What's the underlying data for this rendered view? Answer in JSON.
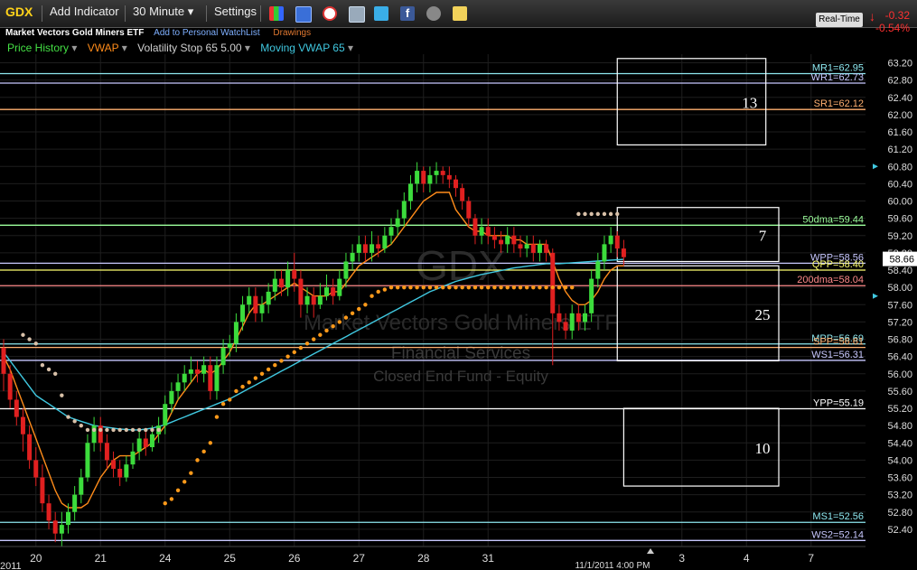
{
  "toolbar": {
    "symbol": "GDX",
    "add_indicator": "Add Indicator",
    "interval": "30 Minute",
    "settings": "Settings",
    "realtime": "Real-Time",
    "change": "-0.32",
    "change_pct": "-0.54%"
  },
  "subbar": {
    "name": "Market Vectors Gold Miners ETF",
    "watchlist": "Add to Personal WatchList",
    "drawings": "Drawings"
  },
  "indicators": [
    {
      "label": "Price History",
      "color": "#44e044"
    },
    {
      "label": "VWAP",
      "color": "#ff8c1a"
    },
    {
      "label": "Volatility Stop 65 5.00",
      "color": "#cfcfcf"
    },
    {
      "label": "Moving VWAP 65",
      "color": "#40c8e0"
    }
  ],
  "watermark": {
    "symbol": "GDX",
    "name": "Market Vectors Gold Miners ETF",
    "sector": "Financial Services",
    "category": "Closed End Fund - Equity"
  },
  "chart_data": {
    "type": "candlestick",
    "ylim": [
      52.0,
      63.4
    ],
    "y_ticks": [
      "63.20",
      "62.80",
      "62.40",
      "62.00",
      "61.60",
      "61.20",
      "60.80",
      "60.40",
      "60.00",
      "59.60",
      "59.20",
      "58.80",
      "58.40",
      "58.00",
      "57.60",
      "57.20",
      "56.80",
      "56.40",
      "56.00",
      "55.60",
      "55.20",
      "54.80",
      "54.40",
      "54.00",
      "53.60",
      "53.20",
      "52.80",
      "52.40"
    ],
    "x_labels": [
      {
        "label": "20",
        "i": 5
      },
      {
        "label": "21",
        "i": 15
      },
      {
        "label": "24",
        "i": 25
      },
      {
        "label": "25",
        "i": 35
      },
      {
        "label": "26",
        "i": 45
      },
      {
        "label": "27",
        "i": 55
      },
      {
        "label": "28",
        "i": 65
      },
      {
        "label": "31",
        "i": 75
      },
      {
        "label": "3",
        "i": 105
      },
      {
        "label": "4",
        "i": 115
      },
      {
        "label": "7",
        "i": 125
      }
    ],
    "year_label": "2011",
    "cursor_date": "11/1/2011 4:00 PM",
    "last_price": "58.66",
    "levels": [
      {
        "label": "MR1=62.95",
        "value": 62.95,
        "color": "#8ee8f0"
      },
      {
        "label": "WR1=62.73",
        "value": 62.73,
        "color": "#c8c8ff"
      },
      {
        "label": "SR1=62.12",
        "value": 62.12,
        "color": "#ffb070"
      },
      {
        "label": "50dma=59.44",
        "value": 59.44,
        "color": "#9cff9c"
      },
      {
        "label": "WPP=58.56",
        "value": 58.56,
        "color": "#c8c8ff"
      },
      {
        "label": "QPP=58.40",
        "value": 58.4,
        "color": "#ffff70"
      },
      {
        "label": "200dma=58.04",
        "value": 58.04,
        "color": "#ff8a8a"
      },
      {
        "label": "MPP=56.69",
        "value": 56.69,
        "color": "#8ee8f0"
      },
      {
        "label": "SPP=56.61",
        "value": 56.61,
        "color": "#ffb070"
      },
      {
        "label": "WS1=56.31",
        "value": 56.31,
        "color": "#c8c8ff"
      },
      {
        "label": "YPP=55.19",
        "value": 55.19,
        "color": "#ffffff"
      },
      {
        "label": "MS1=52.56",
        "value": 52.56,
        "color": "#8ee8f0"
      },
      {
        "label": "WS2=52.14",
        "value": 52.14,
        "color": "#c8c8ff"
      }
    ],
    "boxes": [
      {
        "label": "13",
        "i0": 95,
        "i1": 118,
        "top": 63.3,
        "bottom": 61.3
      },
      {
        "label": "7",
        "i0": 95,
        "i1": 120,
        "top": 59.85,
        "bottom": 58.6
      },
      {
        "label": "25",
        "i0": 95,
        "i1": 120,
        "top": 58.5,
        "bottom": 56.3
      },
      {
        "label": "10",
        "i0": 96,
        "i1": 120,
        "top": 55.2,
        "bottom": 53.4
      }
    ],
    "candles": [
      [
        56.6,
        56.0,
        56.8,
        55.6
      ],
      [
        56.0,
        55.4,
        56.2,
        55.2
      ],
      [
        55.4,
        55.0,
        55.6,
        54.8
      ],
      [
        55.0,
        54.6,
        55.2,
        54.2
      ],
      [
        54.6,
        54.0,
        54.8,
        53.8
      ],
      [
        54.0,
        53.6,
        54.3,
        53.4
      ],
      [
        53.6,
        53.0,
        53.9,
        52.8
      ],
      [
        53.0,
        52.6,
        53.2,
        52.4
      ],
      [
        52.6,
        52.3,
        52.8,
        52.1
      ],
      [
        52.3,
        52.5,
        52.8,
        52.0
      ],
      [
        52.5,
        52.8,
        53.0,
        52.3
      ],
      [
        52.8,
        53.2,
        53.4,
        52.6
      ],
      [
        53.2,
        53.6,
        53.8,
        53.0
      ],
      [
        53.6,
        54.4,
        54.6,
        53.5
      ],
      [
        54.4,
        54.8,
        55.0,
        54.2
      ],
      [
        54.8,
        54.4,
        55.0,
        54.2
      ],
      [
        54.4,
        54.0,
        54.6,
        53.8
      ],
      [
        54.0,
        53.8,
        54.2,
        53.6
      ],
      [
        53.8,
        53.6,
        54.0,
        53.4
      ],
      [
        53.6,
        53.9,
        54.1,
        53.5
      ],
      [
        53.9,
        54.2,
        54.4,
        53.8
      ],
      [
        54.2,
        54.5,
        54.7,
        54.0
      ],
      [
        54.5,
        54.3,
        54.7,
        54.1
      ],
      [
        54.3,
        54.6,
        54.8,
        54.2
      ],
      [
        54.6,
        54.8,
        55.0,
        54.4
      ],
      [
        54.8,
        55.3,
        55.5,
        54.6
      ],
      [
        55.3,
        55.6,
        55.8,
        55.1
      ],
      [
        55.6,
        55.8,
        56.0,
        55.4
      ],
      [
        55.8,
        56.0,
        56.2,
        55.6
      ],
      [
        56.0,
        56.1,
        56.4,
        55.8
      ],
      [
        56.1,
        56.0,
        56.3,
        55.8
      ],
      [
        56.0,
        56.2,
        56.4,
        55.8
      ],
      [
        56.2,
        55.6,
        56.4,
        55.4
      ],
      [
        55.6,
        56.2,
        56.4,
        55.4
      ],
      [
        56.2,
        56.6,
        56.8,
        56.0
      ],
      [
        56.6,
        56.7,
        56.9,
        56.4
      ],
      [
        56.7,
        57.2,
        57.4,
        56.5
      ],
      [
        57.2,
        57.6,
        57.8,
        57.0
      ],
      [
        57.6,
        57.8,
        58.0,
        57.4
      ],
      [
        57.8,
        57.4,
        58.0,
        57.2
      ],
      [
        57.4,
        57.6,
        57.8,
        57.2
      ],
      [
        57.6,
        57.9,
        58.1,
        57.4
      ],
      [
        57.9,
        58.2,
        58.4,
        57.7
      ],
      [
        58.2,
        58.0,
        58.4,
        57.8
      ],
      [
        58.0,
        58.4,
        58.6,
        57.8
      ],
      [
        58.4,
        58.2,
        58.8,
        57.9
      ],
      [
        58.2,
        57.6,
        58.4,
        57.3
      ],
      [
        57.6,
        57.8,
        58.0,
        57.4
      ],
      [
        57.8,
        57.6,
        58.0,
        57.3
      ],
      [
        57.6,
        57.8,
        58.1,
        57.5
      ],
      [
        57.8,
        58.0,
        58.3,
        57.7
      ],
      [
        58.0,
        57.8,
        58.2,
        57.6
      ],
      [
        57.8,
        58.2,
        58.4,
        57.7
      ],
      [
        58.2,
        58.6,
        58.8,
        58.0
      ],
      [
        58.6,
        58.8,
        59.0,
        58.4
      ],
      [
        58.8,
        59.0,
        59.2,
        58.6
      ],
      [
        59.0,
        58.8,
        59.2,
        58.6
      ],
      [
        58.8,
        59.0,
        59.3,
        58.6
      ],
      [
        59.0,
        58.9,
        59.2,
        58.7
      ],
      [
        58.9,
        59.2,
        59.4,
        58.8
      ],
      [
        59.2,
        59.4,
        59.6,
        59.0
      ],
      [
        59.4,
        59.6,
        59.8,
        59.2
      ],
      [
        59.6,
        60.0,
        60.2,
        59.4
      ],
      [
        60.0,
        60.4,
        60.6,
        59.8
      ],
      [
        60.4,
        60.7,
        60.9,
        60.2
      ],
      [
        60.7,
        60.4,
        60.8,
        60.2
      ],
      [
        60.4,
        60.6,
        60.8,
        60.2
      ],
      [
        60.6,
        60.7,
        60.9,
        60.4
      ],
      [
        60.7,
        60.6,
        60.8,
        60.4
      ],
      [
        60.6,
        60.5,
        60.8,
        60.3
      ],
      [
        60.5,
        60.3,
        60.6,
        60.1
      ],
      [
        60.3,
        60.0,
        60.4,
        59.8
      ],
      [
        60.0,
        59.6,
        60.1,
        59.4
      ],
      [
        59.6,
        59.2,
        59.7,
        59.0
      ],
      [
        59.2,
        59.4,
        59.6,
        59.0
      ],
      [
        59.4,
        59.2,
        59.6,
        59.0
      ],
      [
        59.2,
        59.1,
        59.4,
        58.9
      ],
      [
        59.1,
        59.0,
        59.3,
        58.8
      ],
      [
        59.0,
        59.2,
        59.4,
        58.8
      ],
      [
        59.2,
        59.0,
        59.4,
        58.8
      ],
      [
        59.0,
        58.9,
        59.2,
        58.7
      ],
      [
        58.9,
        59.0,
        59.2,
        58.7
      ],
      [
        59.0,
        58.8,
        59.2,
        58.6
      ],
      [
        58.8,
        59.0,
        59.1,
        58.6
      ],
      [
        59.0,
        58.8,
        59.1,
        58.6
      ],
      [
        58.8,
        57.4,
        58.9,
        56.2
      ],
      [
        57.4,
        57.2,
        57.6,
        57.0
      ],
      [
        57.2,
        57.0,
        57.4,
        56.8
      ],
      [
        57.0,
        57.4,
        57.6,
        56.8
      ],
      [
        57.4,
        57.2,
        57.6,
        57.0
      ],
      [
        57.2,
        57.4,
        57.6,
        57.0
      ],
      [
        57.4,
        58.2,
        58.4,
        57.2
      ],
      [
        58.2,
        58.6,
        58.8,
        58.0
      ],
      [
        58.6,
        59.0,
        59.2,
        58.4
      ],
      [
        59.0,
        59.2,
        59.4,
        58.8
      ],
      [
        59.2,
        58.9,
        59.3,
        58.7
      ],
      [
        58.9,
        58.7,
        59.1,
        58.5
      ]
    ],
    "vwap": [
      56.4,
      56.1,
      55.7,
      55.3,
      54.9,
      54.5,
      54.1,
      53.7,
      53.3,
      53.0,
      52.9,
      52.9,
      52.9,
      53.0,
      53.3,
      53.6,
      53.8,
      54.0,
      54.1,
      54.1,
      54.1,
      54.2,
      54.3,
      54.4,
      54.6,
      54.8,
      55.1,
      55.4,
      55.6,
      55.8,
      56.0,
      56.1,
      56.0,
      56.1,
      56.3,
      56.5,
      56.8,
      57.1,
      57.4,
      57.6,
      57.6,
      57.7,
      57.8,
      57.9,
      58.0,
      58.1,
      58.0,
      57.9,
      57.8,
      57.8,
      57.8,
      57.9,
      57.9,
      58.1,
      58.3,
      58.5,
      58.6,
      58.7,
      58.8,
      58.9,
      59.0,
      59.2,
      59.4,
      59.6,
      59.8,
      60.0,
      60.1,
      60.2,
      60.2,
      60.2,
      59.8,
      59.6,
      59.4,
      59.3,
      59.3,
      59.2,
      59.2,
      59.2,
      59.2,
      59.1,
      59.1,
      59.0,
      59.0,
      59.0,
      59.0,
      58.6,
      58.2,
      57.9,
      57.7,
      57.6,
      57.6,
      57.7,
      57.9,
      58.2,
      58.4,
      58.5,
      58.5
    ],
    "mvwap": [
      56.5,
      56.3,
      56.1,
      55.9,
      55.7,
      55.5,
      55.4,
      55.3,
      55.2,
      55.1,
      55.0,
      54.95,
      54.9,
      54.85,
      54.8,
      54.78,
      54.76,
      54.74,
      54.72,
      54.71,
      54.7,
      54.7,
      54.72,
      54.74,
      54.78,
      54.82,
      54.88,
      54.94,
      55.0,
      55.06,
      55.12,
      55.18,
      55.24,
      55.3,
      55.36,
      55.42,
      55.5,
      55.58,
      55.66,
      55.74,
      55.82,
      55.9,
      55.98,
      56.06,
      56.14,
      56.22,
      56.3,
      56.38,
      56.46,
      56.54,
      56.62,
      56.7,
      56.78,
      56.86,
      56.94,
      57.02,
      57.1,
      57.18,
      57.26,
      57.34,
      57.42,
      57.5,
      57.58,
      57.66,
      57.74,
      57.82,
      57.9,
      57.96,
      58.02,
      58.08,
      58.14,
      58.18,
      58.22,
      58.26,
      58.3,
      58.33,
      58.36,
      58.39,
      58.42,
      58.45,
      58.47,
      58.49,
      58.51,
      58.53,
      58.55,
      58.55,
      58.55,
      58.56,
      58.57,
      58.58,
      58.59,
      58.6,
      58.61,
      58.62,
      58.63,
      58.64,
      58.65
    ],
    "vstop": [
      [
        3,
        56.9
      ],
      [
        4,
        56.8
      ],
      [
        5,
        56.7
      ],
      [
        6,
        56.2
      ],
      [
        7,
        56.1
      ],
      [
        8,
        56.0
      ],
      [
        9,
        55.5
      ],
      [
        10,
        55.0
      ],
      [
        11,
        54.9
      ],
      [
        12,
        54.8
      ],
      [
        13,
        54.7
      ],
      [
        14,
        54.7
      ],
      [
        15,
        54.7
      ],
      [
        16,
        54.7
      ],
      [
        17,
        54.7
      ],
      [
        18,
        54.7
      ],
      [
        19,
        54.7
      ],
      [
        20,
        54.7
      ],
      [
        21,
        54.7
      ],
      [
        22,
        54.7
      ],
      [
        23,
        54.7
      ],
      [
        24,
        54.7
      ],
      [
        25,
        53.0
      ],
      [
        26,
        53.1
      ],
      [
        27,
        53.3
      ],
      [
        28,
        53.5
      ],
      [
        29,
        53.7
      ],
      [
        30,
        54.0
      ],
      [
        31,
        54.2
      ],
      [
        32,
        54.4
      ],
      [
        33,
        55.0
      ],
      [
        34,
        55.3
      ],
      [
        35,
        55.4
      ],
      [
        36,
        55.6
      ],
      [
        37,
        55.7
      ],
      [
        38,
        55.8
      ],
      [
        39,
        55.9
      ],
      [
        40,
        56.0
      ],
      [
        41,
        56.1
      ],
      [
        42,
        56.2
      ],
      [
        43,
        56.3
      ],
      [
        44,
        56.4
      ],
      [
        45,
        56.5
      ],
      [
        46,
        56.6
      ],
      [
        47,
        56.7
      ],
      [
        48,
        56.8
      ],
      [
        49,
        56.9
      ],
      [
        50,
        57.0
      ],
      [
        51,
        57.1
      ],
      [
        52,
        57.2
      ],
      [
        53,
        57.3
      ],
      [
        54,
        57.4
      ],
      [
        55,
        57.5
      ],
      [
        56,
        57.6
      ],
      [
        57,
        57.8
      ],
      [
        58,
        57.9
      ],
      [
        59,
        57.95
      ],
      [
        60,
        58.0
      ],
      [
        61,
        58.0
      ],
      [
        62,
        58.0
      ],
      [
        63,
        58.0
      ],
      [
        64,
        58.0
      ],
      [
        65,
        58.0
      ],
      [
        66,
        58.0
      ],
      [
        67,
        58.0
      ],
      [
        68,
        58.0
      ],
      [
        69,
        58.0
      ],
      [
        70,
        58.0
      ],
      [
        71,
        58.0
      ],
      [
        72,
        58.0
      ],
      [
        73,
        58.0
      ],
      [
        74,
        58.0
      ],
      [
        75,
        58.0
      ],
      [
        76,
        58.0
      ],
      [
        77,
        58.0
      ],
      [
        78,
        58.0
      ],
      [
        79,
        58.0
      ],
      [
        80,
        58.0
      ],
      [
        81,
        58.0
      ],
      [
        82,
        58.0
      ],
      [
        83,
        58.0
      ],
      [
        84,
        58.0
      ],
      [
        85,
        58.0
      ],
      [
        86,
        58.0
      ],
      [
        87,
        58.0
      ],
      [
        88,
        58.0
      ],
      [
        89,
        59.7
      ],
      [
        90,
        59.7
      ],
      [
        91,
        59.7
      ],
      [
        92,
        59.7
      ],
      [
        93,
        59.7
      ],
      [
        94,
        59.7
      ],
      [
        95,
        59.7
      ]
    ]
  }
}
